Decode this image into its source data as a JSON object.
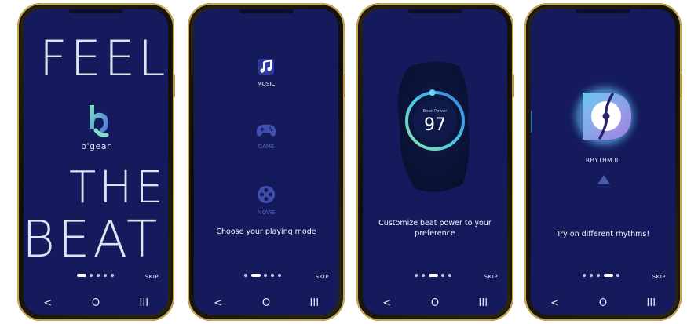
{
  "screens": [
    {
      "big_top": "FEEL",
      "big_mid": "THE",
      "big_bottom": "BEAT",
      "logo_text": "b'gear",
      "skip": "SKIP"
    },
    {
      "modes": [
        {
          "label": "MUSIC",
          "icon": "music-note-icon"
        },
        {
          "label": "GAME",
          "icon": "gamepad-icon"
        },
        {
          "label": "MOVIE",
          "icon": "film-reel-icon"
        }
      ],
      "caption": "Choose your playing mode",
      "skip": "SKIP"
    },
    {
      "gauge_title": "Beat Power",
      "gauge_value": "97",
      "gauge_level": 0.97,
      "caption": "Customize beat power to your preference",
      "skip": "SKIP"
    },
    {
      "rhythm_label": "RHYTHM III",
      "caption": "Try on different rhythms!",
      "skip": "SKIP"
    }
  ],
  "nav": {
    "back": "<",
    "home": "O",
    "recents": "III"
  },
  "colors": {
    "screen_bg": "#141a5c",
    "accent": "#4dc4e8",
    "logo_accent": "#6fd0c4",
    "frame_gold": "#c9a84a"
  }
}
